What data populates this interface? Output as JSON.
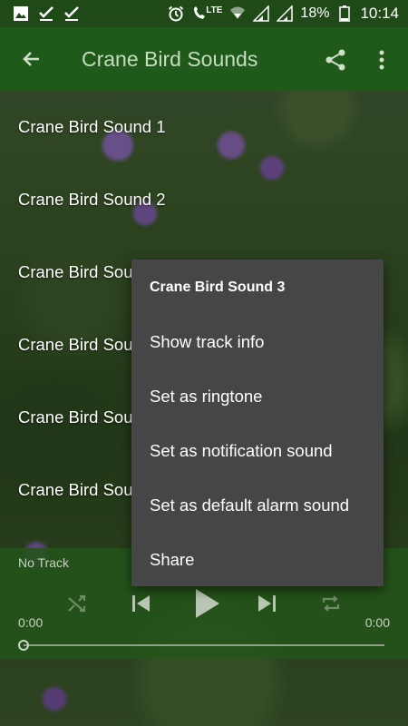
{
  "status_bar": {
    "battery_percent": "18%",
    "time": "10:14",
    "network": "LTE",
    "icons": [
      "image-icon",
      "check-icon",
      "check-icon",
      "alarm-icon",
      "lte-call-icon",
      "wifi-icon",
      "signal-icon",
      "signal-icon",
      "battery-icon"
    ]
  },
  "toolbar": {
    "title": "Crane Bird Sounds",
    "back_icon": "back-arrow-icon",
    "share_icon": "share-icon",
    "more_icon": "more-vert-icon",
    "color": "#1f5a1a"
  },
  "tracks": [
    "Crane Bird Sound 1",
    "Crane Bird Sound 2",
    "Crane Bird Sou",
    "Crane Bird Sou",
    "Crane Bird Sou",
    "Crane Bird Sou"
  ],
  "player": {
    "now_playing": "No Track",
    "elapsed": "0:00",
    "duration": "0:00",
    "progress": 0,
    "controls": [
      "shuffle-icon",
      "previous-icon",
      "play-icon",
      "next-icon",
      "repeat-icon"
    ]
  },
  "context_menu": {
    "title": "Crane Bird Sound 3",
    "items": [
      "Show track info",
      "Set as ringtone",
      "Set as notification sound",
      "Set as default alarm sound",
      "Share"
    ],
    "background": "#474646"
  }
}
